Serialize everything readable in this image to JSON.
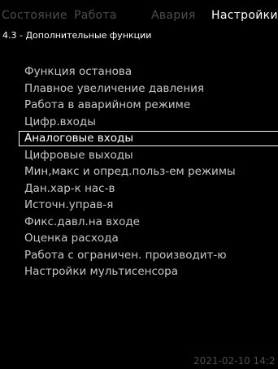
{
  "tabs": [
    {
      "label": "Состояние",
      "active": false
    },
    {
      "label": "Работа",
      "active": false
    },
    {
      "label": "Авария",
      "active": false
    },
    {
      "label": "Настройки",
      "active": true
    }
  ],
  "breadcrumb": "4.3 - Дополнительные функции",
  "menu": {
    "items": [
      {
        "label": "Функция останова",
        "selected": false
      },
      {
        "label": "Плавное увеличение давления",
        "selected": false
      },
      {
        "label": "Работа в аварийном режиме",
        "selected": false
      },
      {
        "label": "Цифр.входы",
        "selected": false
      },
      {
        "label": "Аналоговые входы",
        "selected": true
      },
      {
        "label": "Цифровые выходы",
        "selected": false
      },
      {
        "label": "Мин,макс и опред.польз-ем режимы",
        "selected": false
      },
      {
        "label": "Дан.хар-к нас-в",
        "selected": false
      },
      {
        "label": "Источн.управ-я",
        "selected": false
      },
      {
        "label": "Фикс.давл.на входе",
        "selected": false
      },
      {
        "label": "Оценка расхода",
        "selected": false
      },
      {
        "label": "Работа с ограничен. производит-ю",
        "selected": false
      },
      {
        "label": "Настройки мультисенсора",
        "selected": false
      }
    ]
  },
  "status": {
    "timestamp": "2021-02-10 14:2"
  }
}
